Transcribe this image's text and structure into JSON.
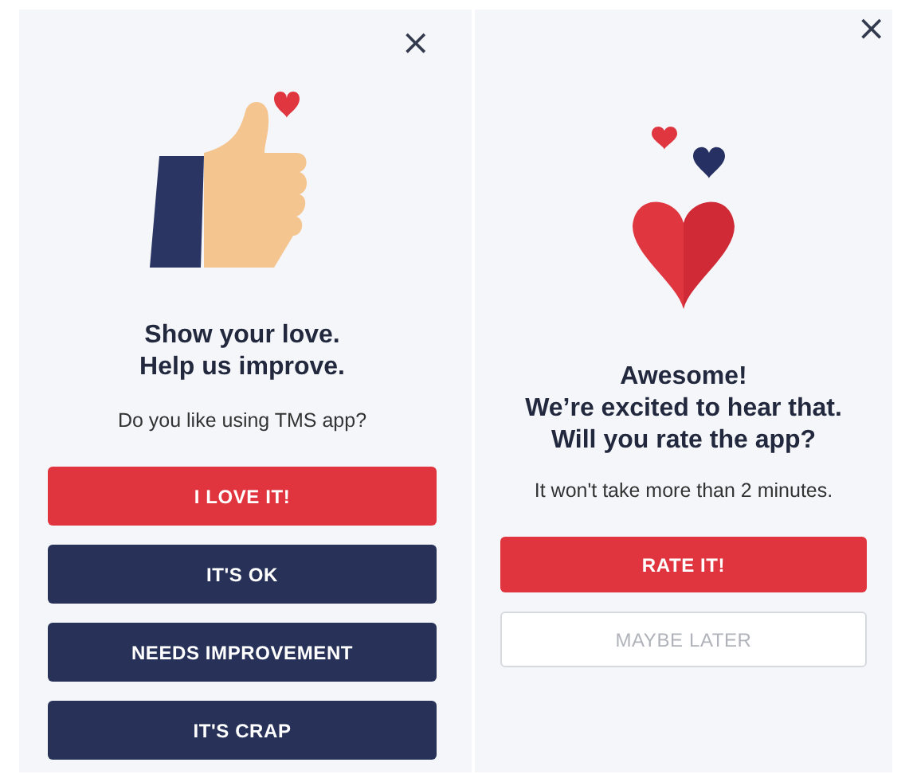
{
  "panels": [
    {
      "kind": "feedback",
      "close": "×",
      "title_lines": [
        "Show your love.",
        "Help us improve."
      ],
      "subtitle": "Do you like using TMS app?",
      "buttons": [
        {
          "label": "I LOVE IT!",
          "kind": "primary"
        },
        {
          "label": "IT'S OK",
          "kind": "secondary"
        },
        {
          "label": "NEEDS IMPROVEMENT",
          "kind": "secondary"
        },
        {
          "label": "IT'S CRAP",
          "kind": "secondary"
        }
      ]
    },
    {
      "kind": "rating",
      "close": "×",
      "title_lines": [
        "Awesome!",
        "We’re excited to hear that.",
        "Will you rate the app?"
      ],
      "subtitle": "It won't take more than 2 minutes.",
      "buttons": [
        {
          "label": "RATE IT!",
          "kind": "primary"
        },
        {
          "label": "MAYBE LATER",
          "kind": "outline"
        }
      ]
    }
  ]
}
